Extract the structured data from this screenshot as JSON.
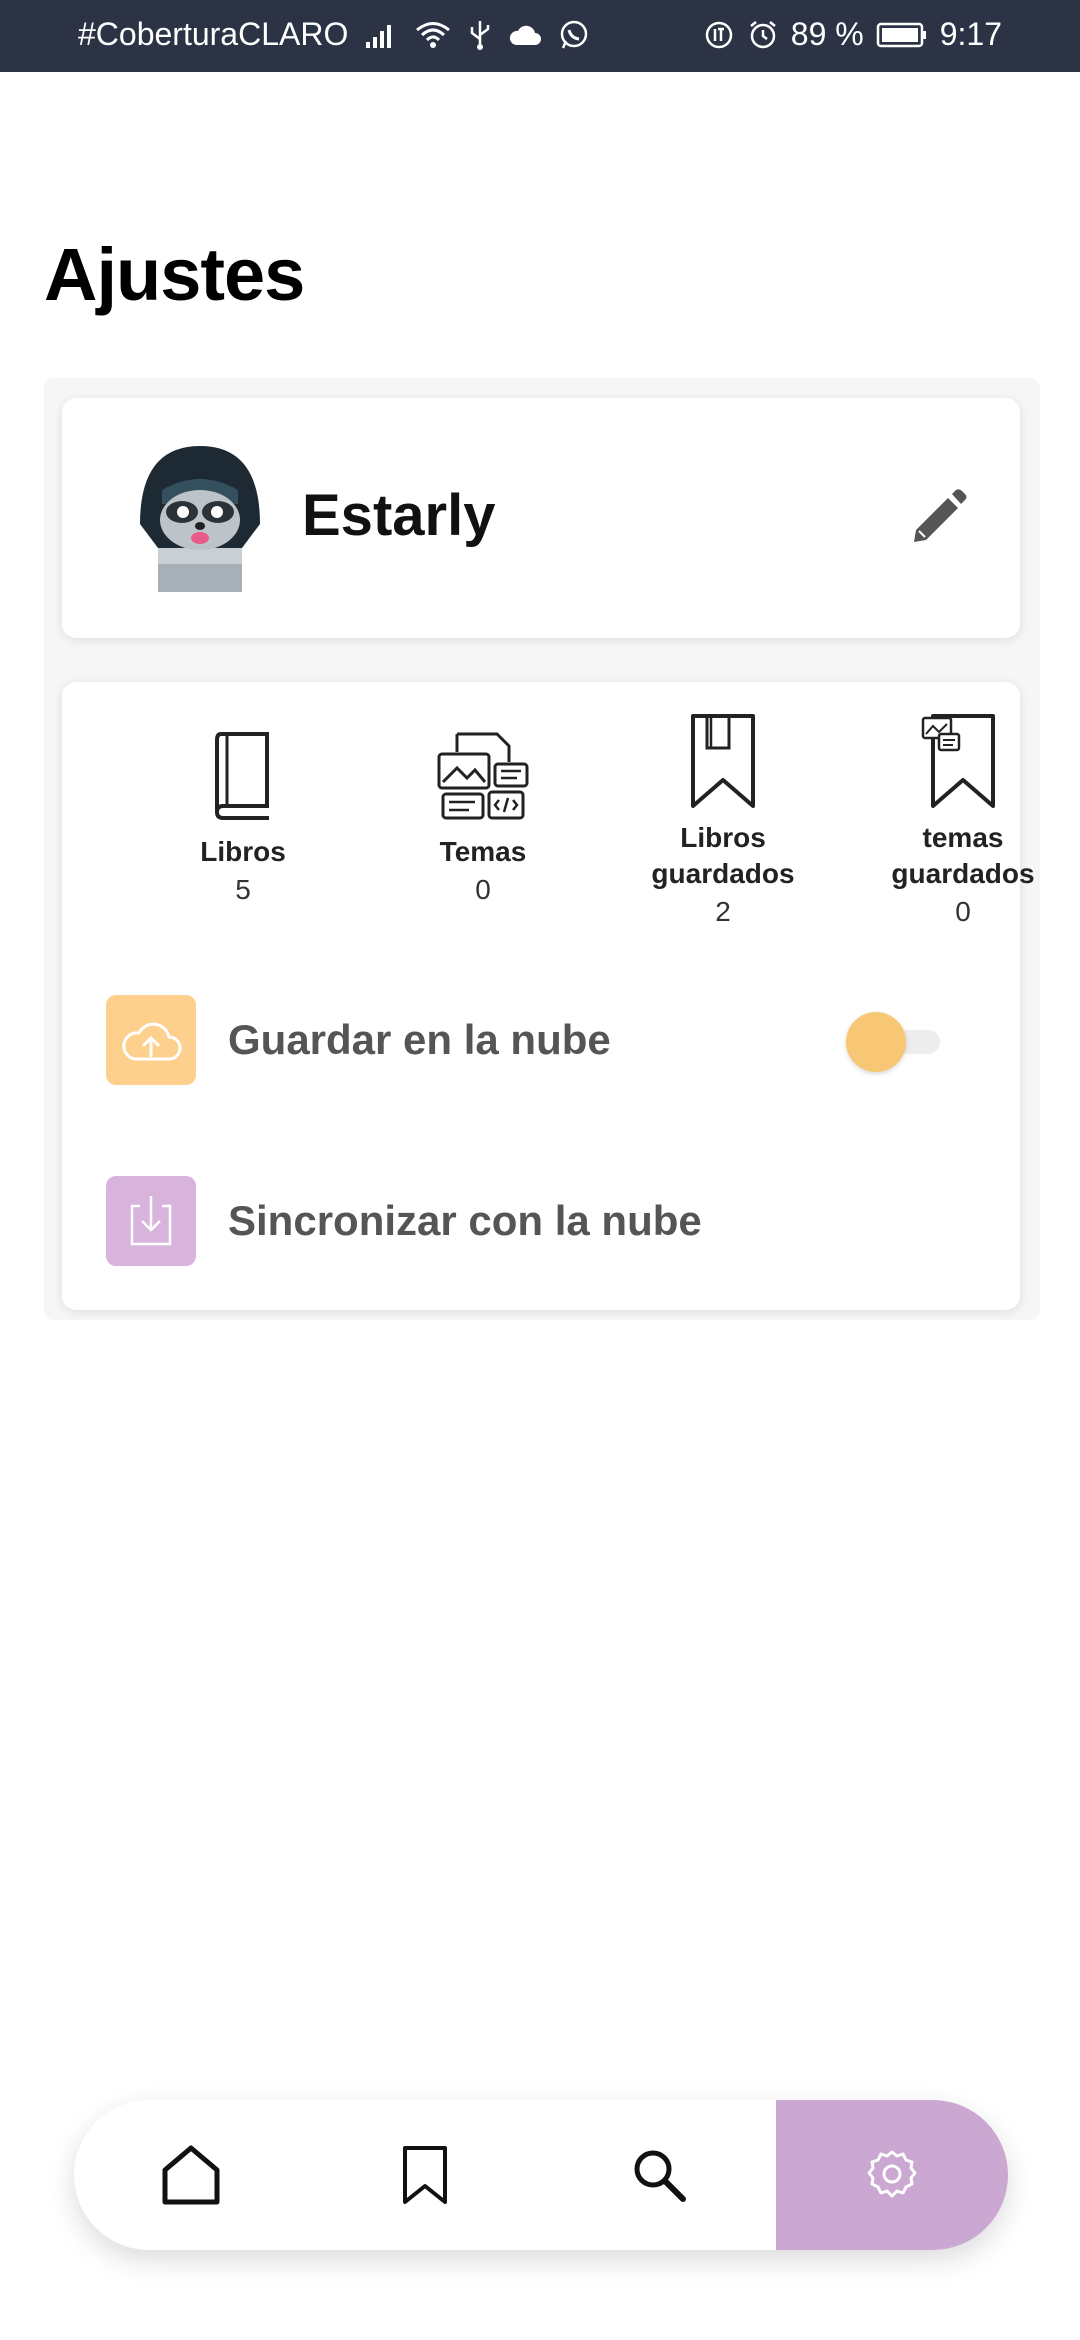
{
  "status_bar": {
    "carrier": "#CoberturaCLARO",
    "battery": "89 %",
    "time": "9:17"
  },
  "page": {
    "title": "Ajustes"
  },
  "profile": {
    "name": "Estarly",
    "avatar_icon": "raccoon-hacker-avatar",
    "edit_icon": "pencil-icon"
  },
  "stats": [
    {
      "label": "Libros",
      "value": "5",
      "icon": "book-icon"
    },
    {
      "label": "Temas",
      "value": "0",
      "icon": "topics-icon"
    },
    {
      "label": "Libros guardados",
      "value": "2",
      "icon": "bookmarked-book-icon"
    },
    {
      "label": "temas guardados",
      "value": "0",
      "icon": "bookmarked-topics-icon"
    }
  ],
  "settings": {
    "save_cloud": {
      "label": "Guardar en la nube",
      "icon": "cloud-upload-icon",
      "enabled": false,
      "tile_color": "#fdd08d"
    },
    "sync_cloud": {
      "label": "Sincronizar con la nube",
      "icon": "download-icon",
      "tile_color": "#d8b3dc"
    }
  },
  "bottom_nav": {
    "items": [
      {
        "name": "home",
        "icon": "home-icon"
      },
      {
        "name": "saved",
        "icon": "bookmark-icon"
      },
      {
        "name": "search",
        "icon": "search-icon"
      },
      {
        "name": "settings",
        "icon": "gear-icon",
        "active": true
      }
    ],
    "active_color": "#cba8d1"
  },
  "colors": {
    "status_bar_bg": "#2c3344",
    "toggle_thumb": "#f7c775",
    "text_dark": "#111111",
    "text_muted": "#555555"
  }
}
